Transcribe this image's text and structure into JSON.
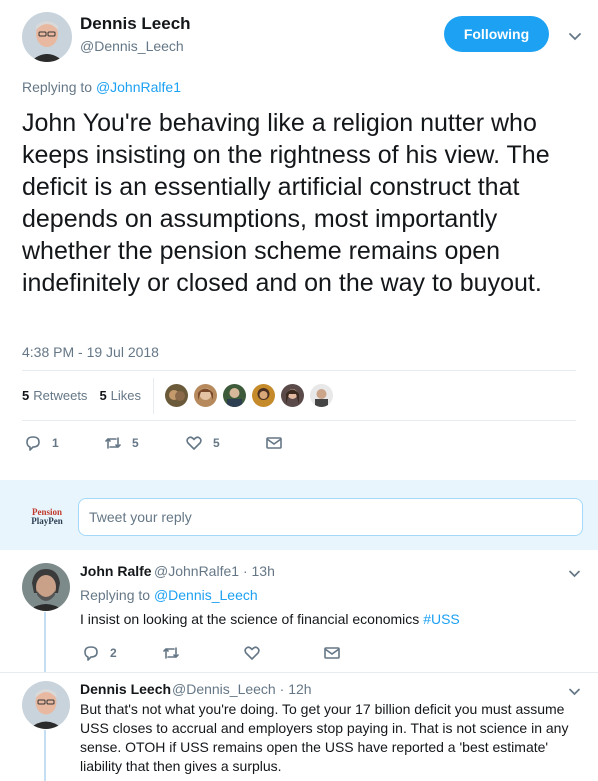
{
  "main_tweet": {
    "author_name": "Dennis Leech",
    "author_handle": "@Dennis_Leech",
    "follow_label": "Following",
    "replying_prefix": "Replying to",
    "replying_to": "@JohnRalfe1",
    "text": "John You're behaving like a religion nutter who keeps insisting on the rightness of his view. The deficit is an essentially artificial construct that depends on assumptions, most importantly whether the pension scheme remains open indefinitely or closed and on the way to buyout.",
    "timestamp": "4:38 PM - 19 Jul 2018",
    "retweets_count": "5",
    "retweets_label": "Retweets",
    "likes_count": "5",
    "likes_label": "Likes",
    "actions": {
      "reply_count": "1",
      "retweet_count": "5",
      "like_count": "5"
    }
  },
  "reply_box": {
    "placeholder": "Tweet your reply",
    "logo_line1": "Pension",
    "logo_line2": "PlayPen"
  },
  "replies": [
    {
      "name": "John Ralfe",
      "handle": "@JohnRalfe1",
      "sep": "·",
      "time": "13h",
      "replying_prefix": "Replying to",
      "replying_to": "@Dennis_Leech",
      "text": "I insist on looking at the science of financial economics ",
      "hashtag": "#USS",
      "reply_count": "2"
    },
    {
      "name": "Dennis Leech",
      "handle": "@Dennis_Leech",
      "sep": "·",
      "time": "12h",
      "text": "But that's not what you're doing. To get your 17 billion deficit you must assume USS closes to accrual and employers stop paying in. That is not science in any sense. OTOH if USS remains open the USS have reported a 'best estimate' liability that then gives a surplus."
    }
  ],
  "colors": {
    "accent": "#1da1f2",
    "text_primary": "#14171a",
    "text_secondary": "#657786",
    "reply_bar_bg": "#e8f5fd",
    "thread_line": "#c4dff3"
  }
}
